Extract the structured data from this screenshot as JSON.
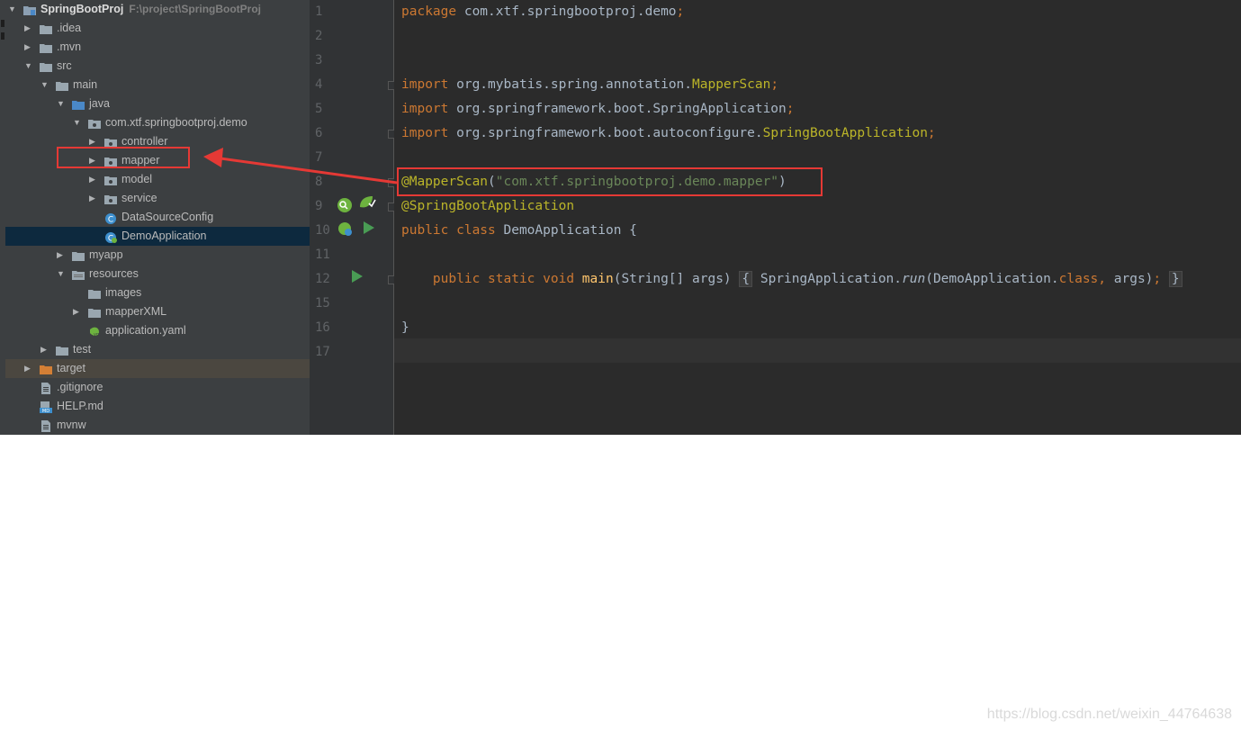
{
  "project_tree": [
    {
      "id": "root",
      "label": "SpringBootProj",
      "hint": "F:\\project\\SpringBootProj",
      "depth": 0,
      "expanded": true,
      "icon": "module-folder-icon"
    },
    {
      "id": "idea",
      "label": ".idea",
      "depth": 1,
      "expanded": false,
      "icon": "folder-icon"
    },
    {
      "id": "mvn",
      "label": ".mvn",
      "depth": 1,
      "expanded": false,
      "icon": "folder-icon"
    },
    {
      "id": "src",
      "label": "src",
      "depth": 1,
      "expanded": true,
      "icon": "folder-icon"
    },
    {
      "id": "main",
      "label": "main",
      "depth": 2,
      "expanded": true,
      "icon": "folder-icon"
    },
    {
      "id": "java",
      "label": "java",
      "depth": 3,
      "expanded": true,
      "icon": "source-folder-icon"
    },
    {
      "id": "pkg",
      "label": "com.xtf.springbootproj.demo",
      "depth": 4,
      "expanded": true,
      "icon": "package-icon"
    },
    {
      "id": "controller",
      "label": "controller",
      "depth": 5,
      "expanded": false,
      "icon": "package-icon"
    },
    {
      "id": "mapper",
      "label": "mapper",
      "depth": 5,
      "expanded": false,
      "icon": "package-icon"
    },
    {
      "id": "model",
      "label": "model",
      "depth": 5,
      "expanded": false,
      "icon": "package-icon"
    },
    {
      "id": "service",
      "label": "service",
      "depth": 5,
      "expanded": false,
      "icon": "package-icon"
    },
    {
      "id": "dsconfig",
      "label": "DataSourceConfig",
      "depth": 5,
      "leaf": true,
      "icon": "class-icon"
    },
    {
      "id": "demoapp",
      "label": "DemoApplication",
      "depth": 5,
      "leaf": true,
      "icon": "spring-boot-class-icon",
      "selected": true
    },
    {
      "id": "myapp",
      "label": "myapp",
      "depth": 3,
      "expanded": false,
      "icon": "folder-icon"
    },
    {
      "id": "resources",
      "label": "resources",
      "depth": 3,
      "expanded": true,
      "icon": "resources-folder-icon"
    },
    {
      "id": "images",
      "label": "images",
      "depth": 4,
      "leaf": true,
      "icon": "folder-icon"
    },
    {
      "id": "mapperxml",
      "label": "mapperXML",
      "depth": 4,
      "expanded": false,
      "icon": "folder-icon"
    },
    {
      "id": "appyaml",
      "label": "application.yaml",
      "depth": 4,
      "leaf": true,
      "icon": "yaml-file-icon"
    },
    {
      "id": "test",
      "label": "test",
      "depth": 2,
      "expanded": false,
      "icon": "folder-icon"
    },
    {
      "id": "target",
      "label": "target",
      "depth": 1,
      "expanded": false,
      "icon": "excluded-folder-icon",
      "excluded": true
    },
    {
      "id": "gitignore",
      "label": ".gitignore",
      "depth": 1,
      "leaf": true,
      "icon": "text-file-icon"
    },
    {
      "id": "help",
      "label": "HELP.md",
      "depth": 1,
      "leaf": true,
      "icon": "markdown-file-icon"
    },
    {
      "id": "mvnw",
      "label": "mvnw",
      "depth": 1,
      "leaf": true,
      "icon": "text-file-icon"
    }
  ],
  "editor": {
    "lines": [
      {
        "num": "1",
        "segments": [
          {
            "t": "package",
            "c": "kw"
          },
          {
            "t": " com.xtf.springbootproj.demo"
          },
          {
            "t": ";",
            "c": "kw"
          }
        ]
      },
      {
        "num": "2",
        "segments": []
      },
      {
        "num": "3",
        "segments": []
      },
      {
        "num": "4",
        "segments": [
          {
            "t": "import",
            "c": "kw"
          },
          {
            "t": " org.mybatis.spring.annotation."
          },
          {
            "t": "MapperScan",
            "c": "ann"
          },
          {
            "t": ";",
            "c": "kw"
          }
        ]
      },
      {
        "num": "5",
        "segments": [
          {
            "t": "import",
            "c": "kw"
          },
          {
            "t": " org.springframework.boot.SpringApplication"
          },
          {
            "t": ";",
            "c": "kw"
          }
        ]
      },
      {
        "num": "6",
        "segments": [
          {
            "t": "import",
            "c": "kw"
          },
          {
            "t": " org.springframework.boot.autoconfigure."
          },
          {
            "t": "SpringBootApplication",
            "c": "ann"
          },
          {
            "t": ";",
            "c": "kw"
          }
        ]
      },
      {
        "num": "7",
        "segments": []
      },
      {
        "num": "8",
        "segments": [
          {
            "t": "@MapperScan",
            "c": "ann"
          },
          {
            "t": "("
          },
          {
            "t": "\"com.xtf.springbootproj.demo.mapper\"",
            "c": "str"
          },
          {
            "t": ")"
          }
        ]
      },
      {
        "num": "9",
        "segments": [
          {
            "t": "@SpringBootApplication",
            "c": "ann"
          }
        ]
      },
      {
        "num": "10",
        "segments": [
          {
            "t": "public class",
            "c": "kw"
          },
          {
            "t": " DemoApplication {"
          }
        ]
      },
      {
        "num": "11",
        "segments": []
      },
      {
        "num": "12",
        "segments": [
          {
            "t": "    "
          },
          {
            "t": "public static void",
            "c": "kw"
          },
          {
            "t": " "
          },
          {
            "t": "main",
            "c": "fn"
          },
          {
            "t": "(String[] args) "
          },
          {
            "t": "{",
            "c": "brace"
          },
          {
            "t": " SpringApplication."
          },
          {
            "t": "run",
            "c": "it"
          },
          {
            "t": "(DemoApplication."
          },
          {
            "t": "class",
            "c": "kw"
          },
          {
            "t": ", ",
            "c": "kw"
          },
          {
            "t": "args)"
          },
          {
            "t": ";",
            "c": "kw"
          },
          {
            "t": " "
          },
          {
            "t": "}",
            "c": "brace"
          }
        ]
      },
      {
        "num": "15",
        "segments": []
      },
      {
        "num": "16",
        "segments": [
          {
            "t": "}"
          }
        ]
      },
      {
        "num": "17",
        "segments": []
      }
    ]
  },
  "watermark": "https://blog.csdn.net/weixin_44764638",
  "colors": {
    "keyword": "#cc7832",
    "annotation": "#bbb529",
    "string": "#6a8759",
    "function": "#ffc66d",
    "highlight": "#e53935"
  }
}
